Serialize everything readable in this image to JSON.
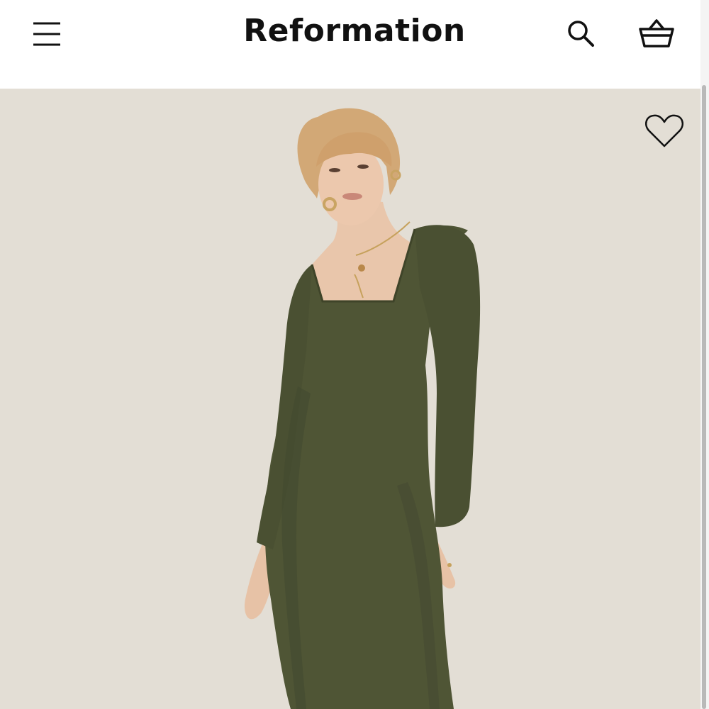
{
  "header": {
    "logo_text": "Reformation",
    "menu_icon": "hamburger-menu-icon",
    "search_icon": "search-icon",
    "bag_icon": "shopping-basket-icon"
  },
  "product_image": {
    "wishlist_icon": "heart-outline-icon",
    "background_color": "#e6e0d8",
    "dress_color": "#4f5535"
  }
}
